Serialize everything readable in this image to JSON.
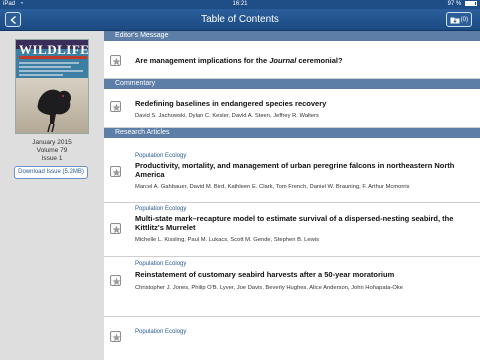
{
  "status_bar": {
    "carrier": "iPad",
    "time": "16:21",
    "battery": "97 %"
  },
  "nav": {
    "title": "Table of Contents",
    "download_count": "(0)"
  },
  "sidebar": {
    "cover": {
      "masthead": "WILDLIFE"
    },
    "issue_date": "January 2015",
    "volume": "Volume 79",
    "issue": "Issue 1",
    "download_button": "Download Issue (5.2MB)"
  },
  "sections": {
    "editors_message": {
      "header": "Editor's Message"
    },
    "commentary": {
      "header": "Commentary"
    },
    "research_articles": {
      "header": "Research Articles"
    }
  },
  "articles": [
    {
      "title_pre": "Are management implications for the ",
      "title_em": "Journal",
      "title_post": " ceremonial?"
    },
    {
      "title": "Redefining baselines in endangered species recovery",
      "authors": "David S. Jachowski, Dylan C. Kesler, David A. Steen, Jeffrey R. Walters"
    },
    {
      "category": "Population Ecology",
      "title": "Productivity, mortality, and management of urban peregrine falcons in northeastern North America",
      "authors": "Marcel A. Gahbauer, David M. Bird, Kathleen E. Clark, Tom French, Daniel W. Brauning, F. Arthur Mcmorris"
    },
    {
      "category": "Population Ecology",
      "title": "Multi-state mark–recapture model to estimate survival of a dispersed-nesting seabird, the Kittlitz's Murrelet",
      "authors": "Michelle L. Kissling, Paul M. Lukacs, Scott M. Gende, Stephen B. Lewis"
    },
    {
      "category": "Population Ecology",
      "title": "Reinstatement of customary seabird harvests after a 50-year moratorium",
      "authors": "Christopher J. Jones, Philip O'B. Lyver, Joe Davis, Beverly Hughes, Alice Anderson, John Hohapata-Oke"
    },
    {
      "category": "Population Ecology"
    }
  ]
}
